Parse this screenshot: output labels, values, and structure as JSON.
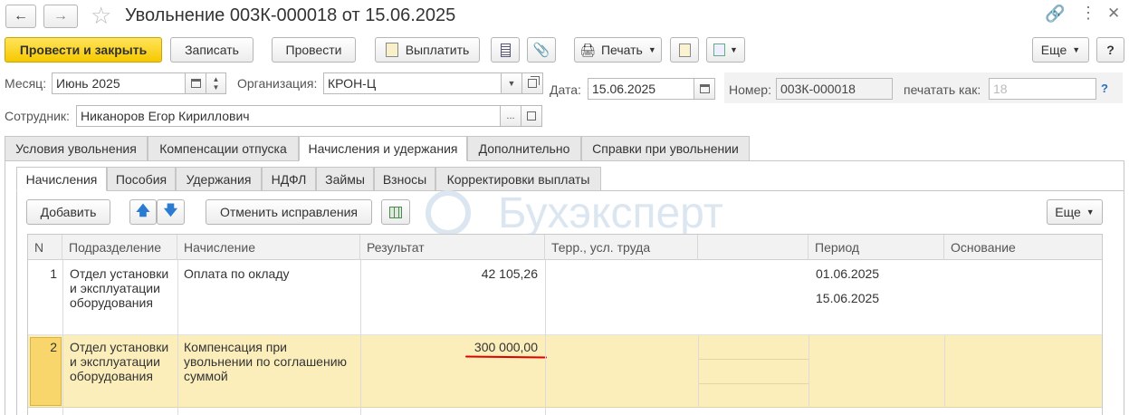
{
  "window": {
    "title": "Увольнение 003К-000018 от 15.06.2025"
  },
  "toolbar": {
    "post_and_close": "Провести и закрыть",
    "save": "Записать",
    "post": "Провести",
    "pay": "Выплатить",
    "print": "Печать",
    "more": "Еще",
    "help": "?"
  },
  "form": {
    "month_label": "Месяц:",
    "month_value": "Июнь 2025",
    "org_label": "Организация:",
    "org_value": "КРОН-Ц",
    "date_label": "Дата:",
    "date_value": "15.06.2025",
    "number_label": "Номер:",
    "number_value": "003К-000018",
    "print_as_label": "печатать как:",
    "print_as_value": "18",
    "help_link": "?",
    "employee_label": "Сотрудник:",
    "employee_value": "Никаноров Егор Кириллович"
  },
  "tabs": [
    {
      "label": "Условия увольнения"
    },
    {
      "label": "Компенсации отпуска"
    },
    {
      "label": "Начисления и удержания"
    },
    {
      "label": "Дополнительно"
    },
    {
      "label": "Справки при увольнении"
    }
  ],
  "subtabs": [
    {
      "label": "Начисления"
    },
    {
      "label": "Пособия"
    },
    {
      "label": "Удержания"
    },
    {
      "label": "НДФЛ"
    },
    {
      "label": "Займы"
    },
    {
      "label": "Взносы"
    },
    {
      "label": "Корректировки выплаты"
    }
  ],
  "table_toolbar": {
    "add": "Добавить",
    "cancel_corrections": "Отменить исправления",
    "more": "Еще"
  },
  "watermark": "Бухэксперт",
  "table": {
    "columns": [
      "N",
      "Подразделение",
      "Начисление",
      "Результат",
      "Терр., усл. труда",
      "",
      "Период",
      "Основание"
    ],
    "rows": [
      {
        "n": "1",
        "department": "Отдел установки и эксплуатации оборудования",
        "accrual": "Оплата по окладу",
        "result": "42 105,26",
        "territory": "",
        "period_start": "01.06.2025",
        "period_end": "15.06.2025",
        "basis": ""
      },
      {
        "n": "2",
        "department": "Отдел установки и эксплуатации оборудования",
        "accrual": "Компенсация при увольнении по соглашению суммой",
        "result": "300 000,00",
        "territory": "",
        "period_start": "",
        "period_end": "",
        "basis": ""
      }
    ]
  },
  "colors": {
    "primary_button": "#f6c800",
    "selected_row": "#fbeebb",
    "selected_cell": "#f8d66b",
    "underline": "#e00000",
    "watermark": "#dbe6f1"
  }
}
